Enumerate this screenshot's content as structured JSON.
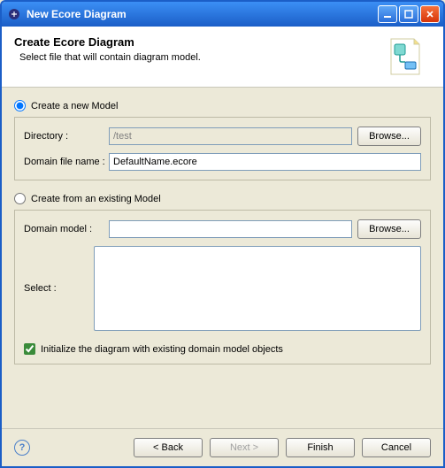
{
  "window": {
    "title": "New Ecore Diagram"
  },
  "header": {
    "title": "Create Ecore Diagram",
    "description": "Select file that will contain diagram model."
  },
  "options": {
    "create_new_label": "Create a new Model",
    "create_existing_label": "Create from an existing Model"
  },
  "new_model": {
    "directory_label": "Directory :",
    "directory_value": "/test",
    "domain_file_label": "Domain file name :",
    "domain_file_value": "DefaultName.ecore",
    "browse_label": "Browse..."
  },
  "existing_model": {
    "domain_model_label": "Domain model :",
    "domain_model_value": "",
    "browse_label": "Browse...",
    "select_label": "Select :",
    "initialize_label": "Initialize the diagram with existing domain model objects",
    "initialize_checked": true
  },
  "footer": {
    "back": "< Back",
    "next": "Next >",
    "finish": "Finish",
    "cancel": "Cancel"
  }
}
